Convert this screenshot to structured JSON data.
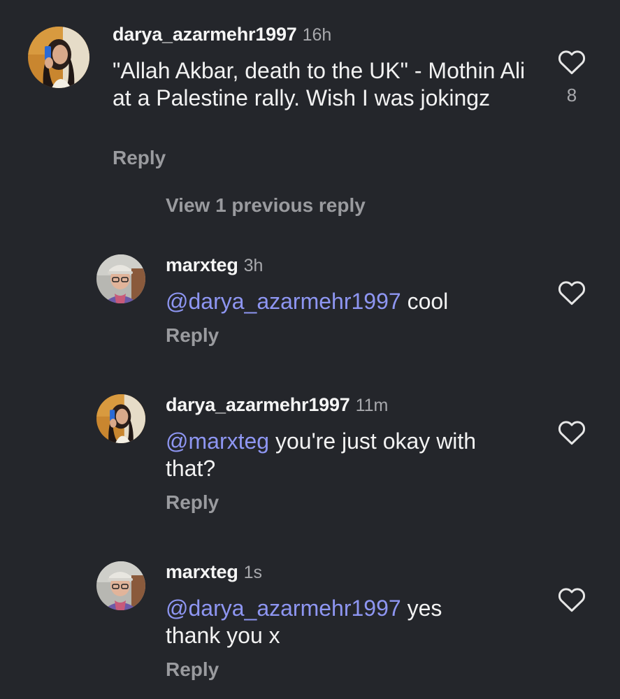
{
  "comments": [
    {
      "username": "darya_azarmehr1997",
      "time": "16h",
      "text": "\"Allah Akbar, death to the UK\" - Mothin Ali at a Palestine rally. Wish I was jokingz",
      "reply": "Reply",
      "likes": "8",
      "avatar_icon": "woman-selfie-avatar"
    }
  ],
  "view_previous": "View 1 previous reply",
  "replies": [
    {
      "username": "marxteg",
      "time": "3h",
      "mention": "@darya_azarmehr1997",
      "text": " cool",
      "reply": "Reply",
      "avatar_icon": "man-cap-avatar"
    },
    {
      "username": "darya_azarmehr1997",
      "time": "11m",
      "mention": "@marxteg",
      "text": " you're just okay with that?",
      "reply": "Reply",
      "avatar_icon": "woman-selfie-avatar"
    },
    {
      "username": "marxteg",
      "time": "1s",
      "mention": "@darya_azarmehr1997",
      "text": " yes thank you x",
      "reply": "Reply",
      "avatar_icon": "man-cap-avatar"
    }
  ],
  "colors": {
    "background": "#24262b",
    "mention": "#8e96f2",
    "secondary_text": "#9a9b9f"
  },
  "icons": {
    "like": "heart-outline-icon"
  }
}
